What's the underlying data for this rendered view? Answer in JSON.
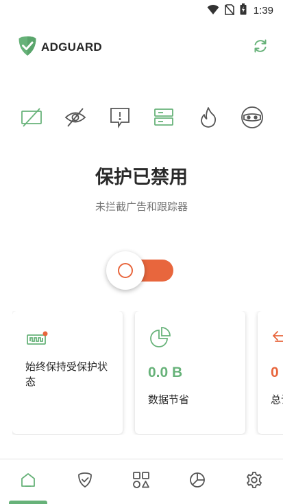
{
  "status_bar": {
    "time": "1:39",
    "icons": [
      "wifi-icon",
      "no-sim-icon",
      "battery-icon"
    ]
  },
  "header": {
    "logo_text": "ADGUARD",
    "logo_icon": "shield-check-icon",
    "refresh_icon": "refresh-icon"
  },
  "features": [
    {
      "name": "ad-blocking-icon"
    },
    {
      "name": "tracking-protection-icon"
    },
    {
      "name": "annoyance-blocking-icon"
    },
    {
      "name": "dns-protection-icon"
    },
    {
      "name": "firewall-icon"
    },
    {
      "name": "stealth-mode-icon"
    }
  ],
  "protection": {
    "title": "保护已禁用",
    "subtitle": "未拦截广告和跟踪器",
    "enabled": false
  },
  "cards": [
    {
      "icon": "always-on-icon",
      "text": "始终保持受保护状态"
    },
    {
      "icon": "pie-chart-icon",
      "value": "0.0 B",
      "label": "数据节省"
    },
    {
      "icon": "blocked-arrow-icon",
      "value": "0",
      "label": "总计拦截"
    }
  ],
  "bottom_nav": {
    "items": [
      "home-icon",
      "protection-icon",
      "apps-icon",
      "statistics-icon",
      "settings-icon"
    ],
    "active": "home-icon"
  },
  "colors": {
    "accent": "#67b279",
    "warning": "#e8663d",
    "text": "#2a2a2a",
    "muted": "#757575"
  }
}
